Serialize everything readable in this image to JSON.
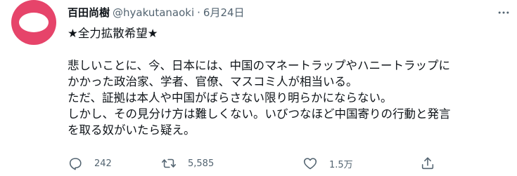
{
  "tweet": {
    "display_name": "百田尚樹",
    "handle": "@hyakutanaoki",
    "separator": "·",
    "date": "6月24日",
    "lines": [
      "★全力拡散希望★",
      "",
      "悲しいことに、今、日本には、中国のマネートラップやハニートラップに",
      "かかった政治家、学者、官僚、マスコミ人が相当いる。",
      "ただ、証拠は本人や中国がばらさない限り明らかにならない。",
      "しかし、その見分け方は難しくない。いびつなほど中国寄りの行動と発言",
      "を取る奴がいたら疑え。"
    ]
  },
  "actions": {
    "reply_count": "242",
    "retweet_count": "5,585",
    "like_count": "1.5万"
  },
  "icons": {
    "avatar": "avatar",
    "more": "more-icon",
    "reply": "reply-icon",
    "retweet": "retweet-icon",
    "like": "heart-icon",
    "share": "share-icon"
  },
  "colors": {
    "avatar": "#e6446a",
    "text": "#0f1419",
    "secondary": "#536471"
  }
}
